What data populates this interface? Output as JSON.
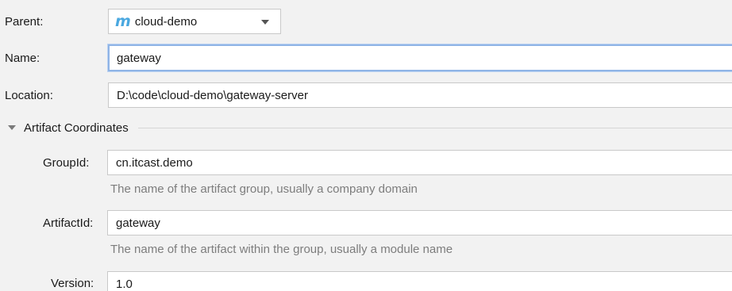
{
  "form": {
    "parent": {
      "label": "Parent:",
      "icon": "maven-module-icon",
      "icon_glyph": "m",
      "value": "cloud-demo"
    },
    "name": {
      "label": "Name:",
      "value": "gateway"
    },
    "location": {
      "label": "Location:",
      "value": "D:\\code\\cloud-demo\\gateway-server"
    },
    "artifact_coordinates": {
      "title": "Artifact Coordinates",
      "expanded": true,
      "group_id": {
        "label": "GroupId:",
        "value": "cn.itcast.demo",
        "hint": "The name of the artifact group, usually a company domain"
      },
      "artifact_id": {
        "label": "ArtifactId:",
        "value": "gateway",
        "hint": "The name of the artifact within the group, usually a module name"
      },
      "version": {
        "label": "Version:",
        "value": "1.0"
      }
    }
  },
  "colors": {
    "background": "#f2f2f2",
    "focus_border": "#8fb4e6",
    "maven_icon": "#4aa8e0",
    "hint_text": "#7d7d7d"
  }
}
